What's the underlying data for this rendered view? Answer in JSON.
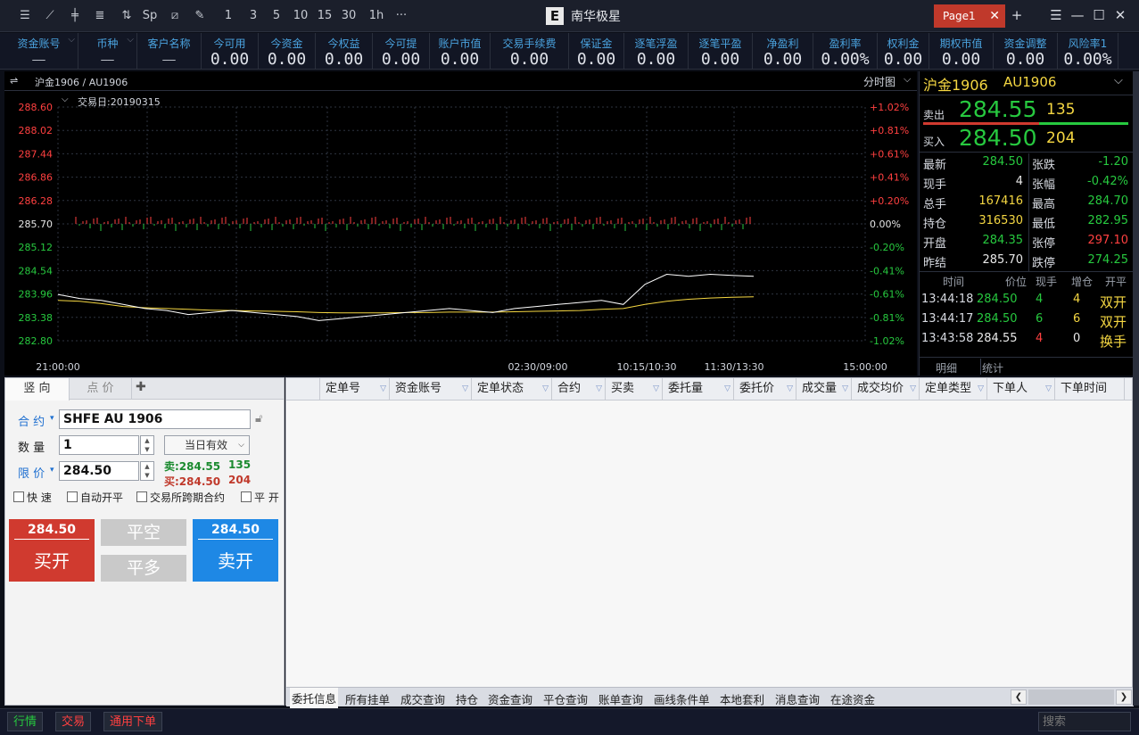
{
  "app": {
    "title": "南华极星",
    "logo": "E",
    "page_tab": "Page1"
  },
  "toolbar": {
    "icons": [
      "menu-list-icon",
      "line-chart-icon",
      "candle-icon",
      "bars-icon",
      "split-icon",
      "sp-text-icon",
      "s-box-icon",
      "pencil-icon",
      "period-1-icon",
      "period-3-icon",
      "period-5-icon",
      "period-10-icon",
      "period-15-icon",
      "period-30-icon",
      "period-1h-icon",
      "more-icon"
    ],
    "labels": [
      "",
      "",
      "",
      "",
      "",
      "Sp",
      "",
      "",
      "1",
      "3",
      "5",
      "10",
      "15",
      "30",
      "1h",
      "···"
    ]
  },
  "account_bar": [
    {
      "label": "资金账号",
      "value": "——",
      "small": true
    },
    {
      "label": "币种",
      "value": "——",
      "small": true
    },
    {
      "label": "客户名称",
      "value": "——",
      "small": true
    },
    {
      "label": "今可用",
      "value": "0.00"
    },
    {
      "label": "今资金",
      "value": "0.00"
    },
    {
      "label": "今权益",
      "value": "0.00"
    },
    {
      "label": "今可提",
      "value": "0.00"
    },
    {
      "label": "账户市值",
      "value": "0.00"
    },
    {
      "label": "交易手续费",
      "value": "0.00"
    },
    {
      "label": "保证金",
      "value": "0.00"
    },
    {
      "label": "逐笔浮盈",
      "value": "0.00"
    },
    {
      "label": "逐笔平盈",
      "value": "0.00"
    },
    {
      "label": "净盈利",
      "value": "0.00"
    },
    {
      "label": "盈利率",
      "value": "0.00%"
    },
    {
      "label": "权利金",
      "value": "0.00"
    },
    {
      "label": "期权市值",
      "value": "0.00"
    },
    {
      "label": "资金调整",
      "value": "0.00"
    },
    {
      "label": "风险率1",
      "value": "0.00%"
    }
  ],
  "chart_header": {
    "instrument": "沪金1906 / AU1906",
    "mode": "分时图",
    "trade_day": "交易日:20190315"
  },
  "chart_data": {
    "type": "line",
    "y_ticks_left": [
      "288.60",
      "288.02",
      "287.44",
      "286.86",
      "286.28",
      "285.70",
      "285.12",
      "284.54",
      "283.96",
      "283.38",
      "282.80"
    ],
    "y_ticks_right": [
      "+1.02%",
      "+0.81%",
      "+0.61%",
      "+0.41%",
      "+0.20%",
      "0.00%",
      "-0.20%",
      "-0.41%",
      "-0.61%",
      "-0.81%",
      "-1.02%"
    ],
    "x_ticks": [
      "21:00:00",
      "02:30/09:00",
      "10:15/10:30",
      "11:30/13:30",
      "15:00:00"
    ],
    "ylim": [
      282.8,
      288.6
    ],
    "prev_close": 285.7,
    "price_series": [
      283.95,
      283.85,
      283.8,
      283.7,
      283.6,
      283.55,
      283.45,
      283.5,
      283.55,
      283.5,
      283.45,
      283.4,
      283.3,
      283.35,
      283.4,
      283.45,
      283.5,
      283.55,
      283.6,
      283.55,
      283.5,
      283.6,
      283.65,
      283.7,
      283.75,
      283.8,
      283.7,
      284.2,
      284.45,
      284.4,
      284.45,
      284.42,
      284.4
    ],
    "avg_series": [
      283.8,
      283.78,
      283.72,
      283.65,
      283.62,
      283.6,
      283.58,
      283.56,
      283.55,
      283.54,
      283.53,
      283.52,
      283.5,
      283.49,
      283.49,
      283.49,
      283.5,
      283.5,
      283.51,
      283.51,
      283.51,
      283.52,
      283.53,
      283.54,
      283.55,
      283.58,
      283.6,
      283.7,
      283.78,
      283.83,
      283.86,
      283.88,
      283.89
    ]
  },
  "quote": {
    "title": "沪金1906",
    "code": "AU1906",
    "sell_label": "卖出",
    "sell_price": "284.55",
    "sell_vol": "135",
    "buy_label": "买入",
    "buy_price": "284.50",
    "buy_vol": "204",
    "stats": [
      {
        "l1": "最新",
        "v1": "284.50",
        "c1": "#27c93f",
        "l2": "张跌",
        "v2": "-1.20",
        "c2": "#27c93f"
      },
      {
        "l1": "现手",
        "v1": "4",
        "c1": "#e8e8e8",
        "l2": "张幅",
        "v2": "-0.42%",
        "c2": "#27c93f"
      },
      {
        "l1": "总手",
        "v1": "167416",
        "c1": "#f5d742",
        "l2": "最高",
        "v2": "284.70",
        "c2": "#27c93f"
      },
      {
        "l1": "持仓",
        "v1": "316530",
        "c1": "#f5d742",
        "l2": "最低",
        "v2": "282.95",
        "c2": "#27c93f"
      },
      {
        "l1": "开盘",
        "v1": "284.35",
        "c1": "#27c93f",
        "l2": "张停",
        "v2": "297.10",
        "c2": "#ff4040"
      },
      {
        "l1": "昨结",
        "v1": "285.70",
        "c1": "#e8e8e8",
        "l2": "跌停",
        "v2": "274.25",
        "c2": "#27c93f"
      }
    ],
    "tick_head": [
      "时间",
      "价位",
      "现手",
      "增仓",
      "开平"
    ],
    "ticks": [
      {
        "t": "13:44:18",
        "p": "284.50",
        "pc": "#27c93f",
        "v": "4",
        "vc": "#27c93f",
        "z": "4",
        "zc": "#f5d742",
        "k": "双开",
        "kc": "#f5d742"
      },
      {
        "t": "13:44:17",
        "p": "284.50",
        "pc": "#27c93f",
        "v": "6",
        "vc": "#27c93f",
        "z": "6",
        "zc": "#f5d742",
        "k": "双开",
        "kc": "#f5d742"
      },
      {
        "t": "13:43:58",
        "p": "284.55",
        "pc": "#e8e8e8",
        "v": "4",
        "vc": "#ff4040",
        "z": "0",
        "zc": "#e8e8e8",
        "k": "换手",
        "kc": "#f5d742"
      }
    ],
    "bottom_tabs": [
      "明细",
      "统计"
    ]
  },
  "order": {
    "tabs": [
      "竖 向",
      "点 价"
    ],
    "contract_label": "合 约",
    "contract": "SHFE AU 1906",
    "qty_label": "数 量",
    "qty": "1",
    "validity": "当日有效",
    "price_label": "限 价",
    "price": "284.50",
    "sell_quote": "卖:284.55",
    "sell_quote_vol": "135",
    "buy_quote": "买:284.50",
    "buy_quote_vol": "204",
    "checks": [
      "快 速",
      "自动开平",
      "交易所跨期合约",
      "平 开"
    ],
    "buy_price": "284.50",
    "buy_open": "买开",
    "close_short": "平空",
    "close_long": "平多",
    "sell_price": "284.50",
    "sell_open": "卖开"
  },
  "grid": {
    "columns": [
      "定单号",
      "资金账号",
      "定单状态",
      "合约",
      "买卖",
      "委托量",
      "委托价",
      "成交量",
      "成交均价",
      "定单类型",
      "下单人",
      "下单时间"
    ],
    "bottom_tabs": [
      "委托信息",
      "所有挂单",
      "成交查询",
      "持仓",
      "资金查询",
      "平仓查询",
      "账单查询",
      "画线条件单",
      "本地套利",
      "消息查询",
      "在途资金"
    ]
  },
  "statusbar": {
    "tabs": [
      "行情",
      "交易",
      "通用下单"
    ],
    "search_placeholder": "搜索"
  },
  "colors": {
    "up": "#ff4040",
    "down": "#27c93f",
    "accent": "#4aa3df",
    "buy": "#d03a2f",
    "sell": "#1e88e5"
  }
}
